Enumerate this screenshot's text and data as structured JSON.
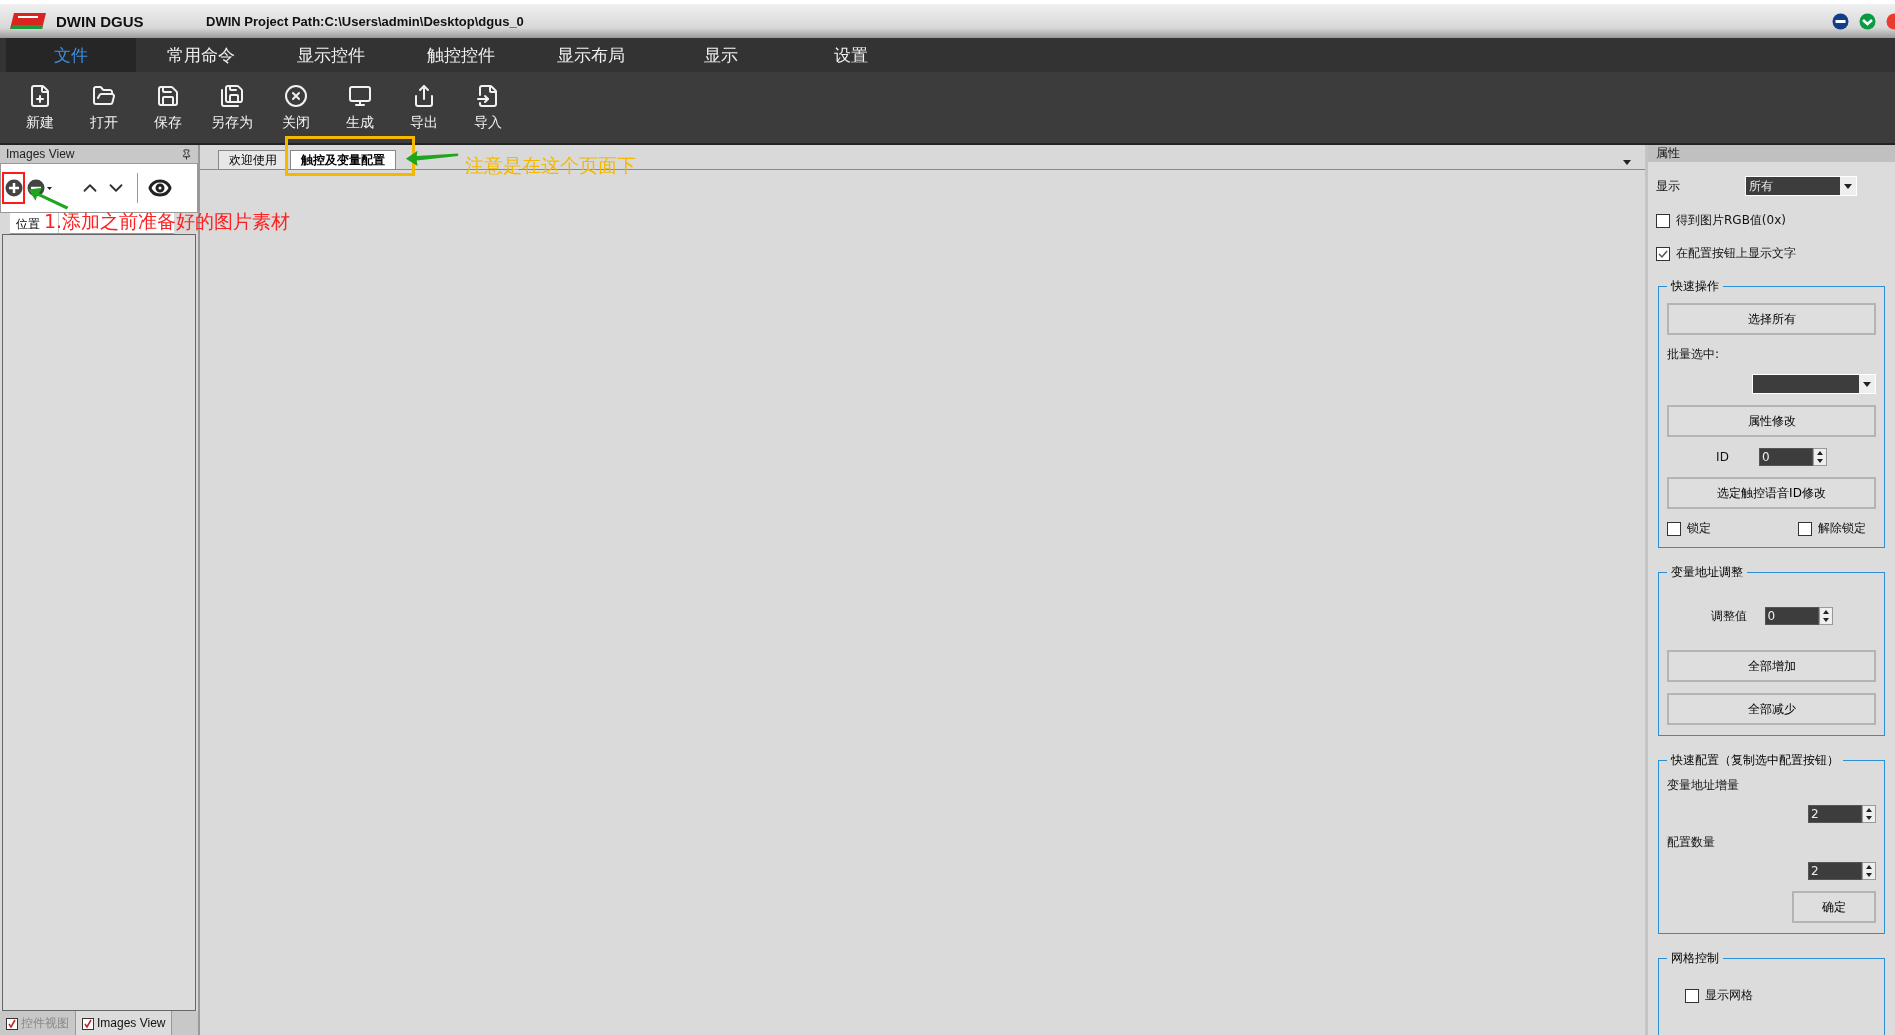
{
  "window": {
    "app_name": "DWIN DGUS",
    "title": "DWIN Project Path:C:\\Users\\admin\\Desktop\\dgus_0"
  },
  "menu": [
    {
      "label": "文件",
      "selected": true
    },
    {
      "label": "常用命令",
      "selected": false
    },
    {
      "label": "显示控件",
      "selected": false
    },
    {
      "label": "触控控件",
      "selected": false
    },
    {
      "label": "显示布局",
      "selected": false
    },
    {
      "label": "显示",
      "selected": false
    },
    {
      "label": "设置",
      "selected": false
    }
  ],
  "toolbar": [
    {
      "label": "新建",
      "kind": "new"
    },
    {
      "label": "打开",
      "kind": "open"
    },
    {
      "label": "保存",
      "kind": "save"
    },
    {
      "label": "另存为",
      "kind": "saveas"
    },
    {
      "label": "关闭",
      "kind": "close"
    },
    {
      "label": "生成",
      "kind": "build"
    },
    {
      "label": "导出",
      "kind": "export"
    },
    {
      "label": "导入",
      "kind": "import"
    }
  ],
  "images_view": {
    "title": "Images View",
    "columns": [
      "位置"
    ]
  },
  "document_tabs": [
    {
      "label": "欢迎使用",
      "selected": false
    },
    {
      "label": "触控及变量配置",
      "selected": true
    }
  ],
  "properties": {
    "title": "属性",
    "display_label": "显示",
    "display_value": "所有",
    "checkboxes": [
      {
        "label": "得到图片RGB值(0x)",
        "checked": false
      },
      {
        "label": "在配置按钮上显示文字",
        "checked": true
      }
    ],
    "quick_ops": {
      "title": "快速操作",
      "select_all": "选择所有",
      "batch_label": "批量选中:",
      "modify": "属性修改",
      "id_label": "ID",
      "id_value": "0",
      "voice_modify": "选定触控语音ID修改",
      "locks": [
        {
          "label": "锁定",
          "checked": false
        },
        {
          "label": "解除锁定",
          "checked": false
        }
      ]
    },
    "address_adjust": {
      "title": "变量地址调整",
      "adjust_label": "调整值",
      "adjust_value": "0",
      "increase": "全部增加",
      "decrease": "全部减少"
    },
    "quick_config": {
      "title": "快速配置（复制选中配置按钮）",
      "increment_label": "变量地址增量",
      "increment_value": "2",
      "count_label": "配置数量",
      "count_value": "2",
      "ok": "确定"
    },
    "grid": {
      "title": "网格控制",
      "show_grid": {
        "label": "显示网格",
        "checked": false
      }
    }
  },
  "bottom_tabs": [
    {
      "label": "控件视图",
      "selected": false
    },
    {
      "label": "Images View",
      "selected": true
    }
  ],
  "annotations": [
    {
      "kind": "red",
      "text": "1.添加之前准备好的图片素材"
    },
    {
      "kind": "orange",
      "text": "注意是在这个页面下"
    }
  ]
}
